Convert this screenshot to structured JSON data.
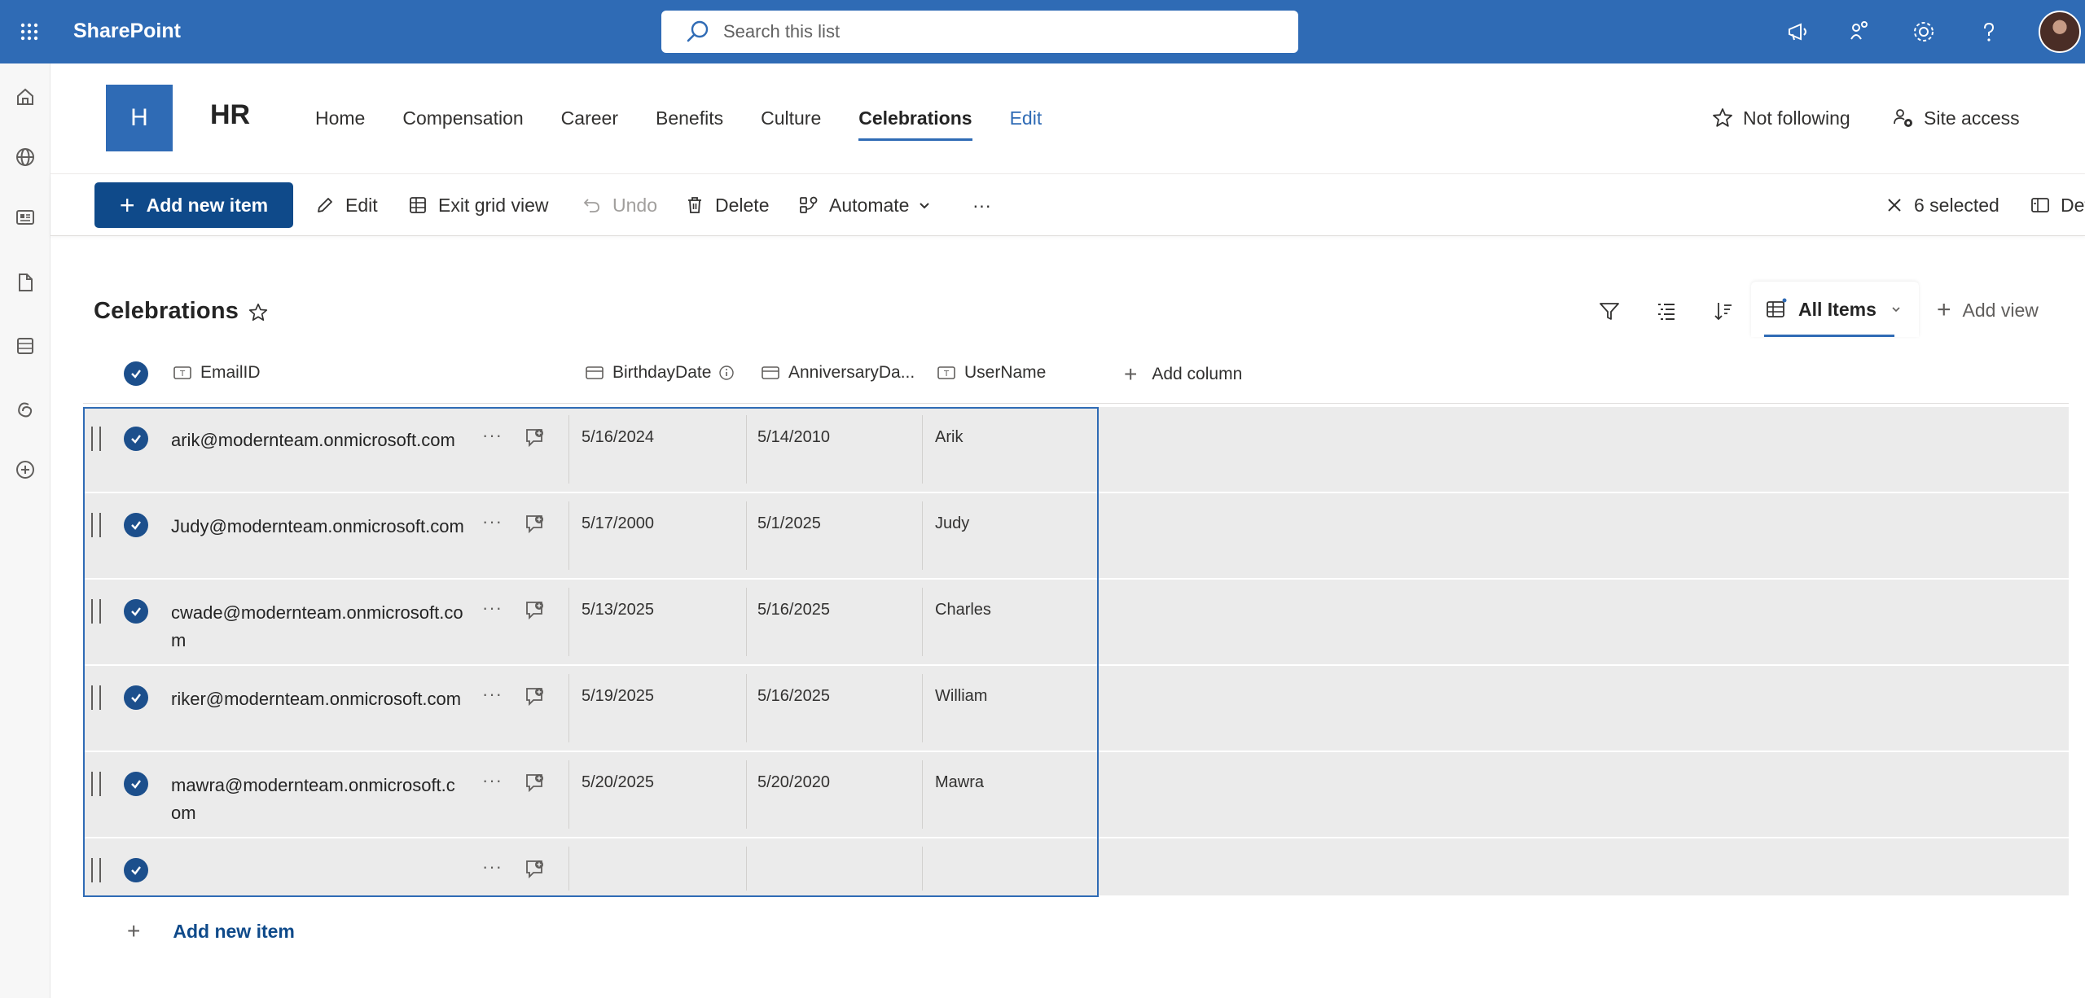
{
  "suite": {
    "brand": "SharePoint",
    "search_placeholder": "Search this list"
  },
  "site": {
    "logo_letter": "H",
    "title": "HR",
    "nav": [
      "Home",
      "Compensation",
      "Career",
      "Benefits",
      "Culture",
      "Celebrations",
      "Edit"
    ],
    "active_nav": "Celebrations",
    "follow_label": "Not following",
    "site_access_label": "Site access"
  },
  "commands": {
    "add_new_item": "Add new item",
    "edit": "Edit",
    "exit_grid": "Exit grid view",
    "undo": "Undo",
    "delete": "Delete",
    "automate": "Automate",
    "more": "···",
    "selected": "6 selected",
    "details": "Details"
  },
  "list": {
    "title": "Celebrations",
    "view_name": "All Items",
    "add_view": "Add view",
    "columns": {
      "email": "EmailID",
      "birthday": "BirthdayDate",
      "anniversary": "AnniversaryDa...",
      "username": "UserName",
      "add_column": "Add column"
    },
    "rows": [
      {
        "email": "arik@modernteam.onmicrosoft.com",
        "birthday": "5/16/2024",
        "anniversary": "5/14/2010",
        "username": "Arik"
      },
      {
        "email": "Judy@modernteam.onmicrosoft.com",
        "birthday": "5/17/2000",
        "anniversary": "5/1/2025",
        "username": "Judy"
      },
      {
        "email": "cwade@modernteam.onmicrosoft.com",
        "birthday": "5/13/2025",
        "anniversary": "5/16/2025",
        "username": "Charles"
      },
      {
        "email": "riker@modernteam.onmicrosoft.com",
        "birthday": "5/19/2025",
        "anniversary": "5/16/2025",
        "username": "William"
      },
      {
        "email": "mawra@modernteam.onmicrosoft.com",
        "birthday": "5/20/2025",
        "anniversary": "5/20/2020",
        "username": "Mawra"
      },
      {
        "email": "",
        "birthday": "",
        "anniversary": "",
        "username": ""
      }
    ],
    "add_new_item": "Add new item"
  },
  "colors": {
    "suitebar": "#2f6bb5",
    "primary": "#0f4a8a",
    "row_bg": "#ebebeb"
  }
}
